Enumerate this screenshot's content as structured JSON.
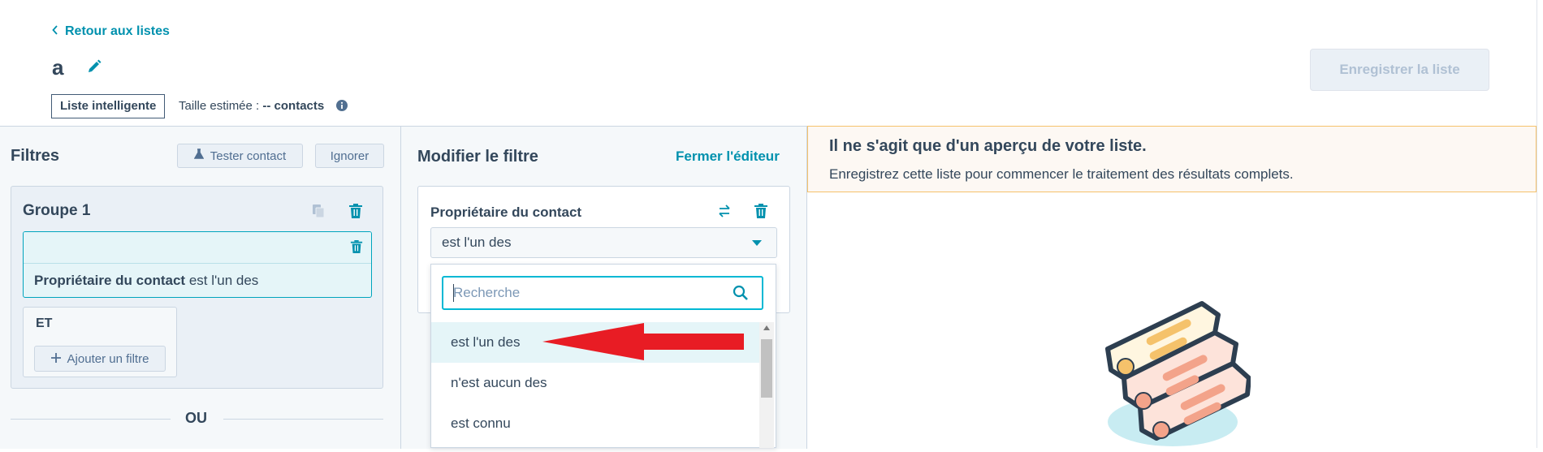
{
  "header": {
    "back_label": "Retour aux listes",
    "list_name": "a",
    "list_type_badge": "Liste intelligente",
    "size_label": "Taille estimée :",
    "size_value": "-- contacts",
    "save_label": "Enregistrer la liste"
  },
  "filters_panel": {
    "title": "Filtres",
    "test_contact_label": "Tester contact",
    "ignore_label": "Ignorer",
    "group": {
      "title": "Groupe 1",
      "filter_property": "Propriétaire du contact",
      "filter_operator": "est l'un des",
      "and_label": "ET",
      "add_filter_label": "Ajouter un filtre"
    },
    "or_label": "OU"
  },
  "editor_panel": {
    "title": "Modifier le filtre",
    "close_label": "Fermer l'éditeur",
    "property_title": "Propriétaire du contact",
    "selected_operator": "est l'un des",
    "search_placeholder": "Recherche",
    "options": [
      "est l'un des",
      "n'est aucun des",
      "est connu"
    ]
  },
  "preview_panel": {
    "notice_title": "Il ne s'agit que d'un aperçu de votre liste.",
    "notice_text": "Enregistrez cette liste pour commencer le traitement des résultats complets."
  },
  "colors": {
    "accent": "#0091ae",
    "text": "#33475b",
    "annotation_arrow": "#e81c24"
  }
}
